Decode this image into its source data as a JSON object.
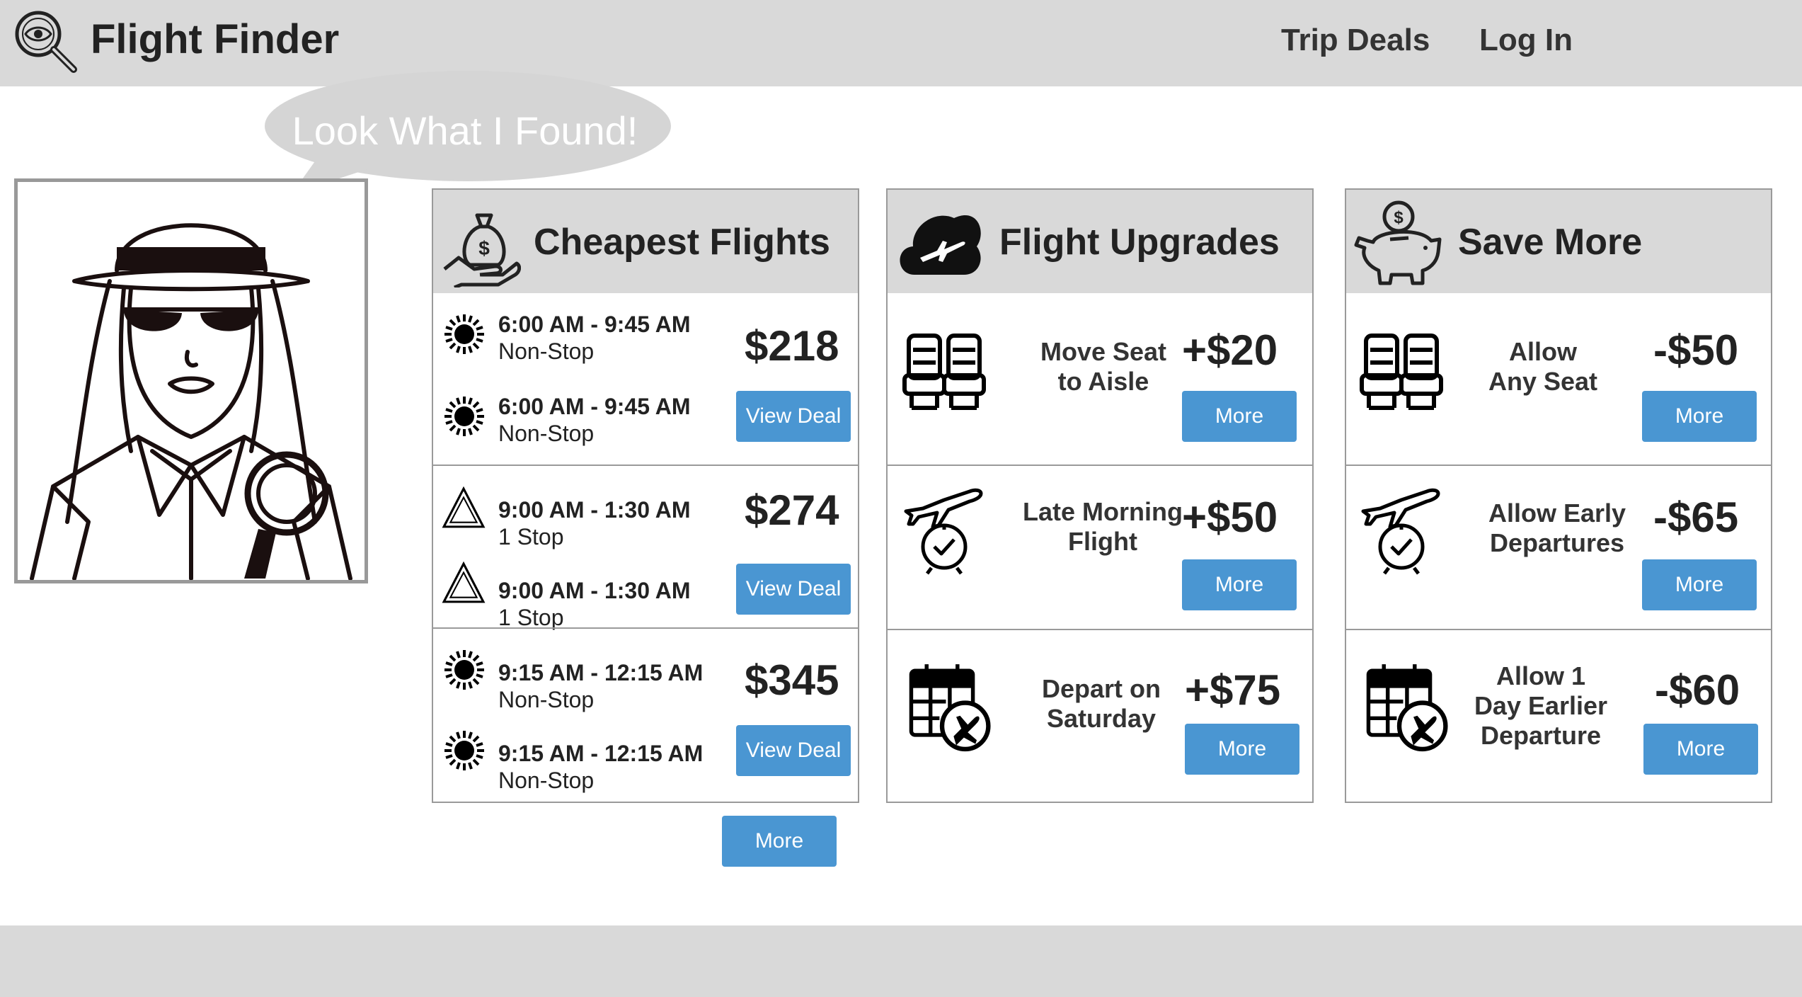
{
  "header": {
    "brand": "Flight Finder",
    "nav": [
      "Trip Deals",
      "Log In"
    ]
  },
  "speech_bubble": "Look What I Found!",
  "cheapest": {
    "title": "Cheapest Flights",
    "deals": [
      {
        "icon": "sun-icon",
        "outbound": {
          "time": "6:00 AM - 9:45 AM",
          "stops": "Non-Stop"
        },
        "return": {
          "time": "6:00 AM - 9:45 AM",
          "stops": "Non-Stop"
        },
        "price": "$218",
        "button": "View Deal"
      },
      {
        "icon": "triangle-icon",
        "outbound": {
          "time": "9:00 AM - 1:30 AM",
          "stops": "1 Stop"
        },
        "return": {
          "time": "9:00 AM - 1:30 AM",
          "stops": "1 Stop"
        },
        "price": "$274",
        "button": "View Deal"
      },
      {
        "icon": "sun-icon",
        "outbound": {
          "time": "9:15 AM - 12:15 AM",
          "stops": "Non-Stop"
        },
        "return": {
          "time": "9:15 AM - 12:15 AM",
          "stops": "Non-Stop"
        },
        "price": "$345",
        "button": "View Deal"
      }
    ],
    "more_button": "More"
  },
  "upgrades": {
    "title": "Flight Upgrades",
    "items": [
      {
        "icon": "seats-icon",
        "label": "Move Seat\nto Aisle",
        "price": "+$20",
        "button": "More"
      },
      {
        "icon": "plane-clock-icon",
        "label": "Late Morning\nFlight",
        "price": "+$50",
        "button": "More"
      },
      {
        "icon": "calendar-plane-icon",
        "label": "Depart on\nSaturday",
        "price": "+$75",
        "button": "More"
      }
    ]
  },
  "save": {
    "title": "Save More",
    "items": [
      {
        "icon": "seats-icon",
        "label": "Allow\nAny Seat",
        "price": "-$50",
        "button": "More"
      },
      {
        "icon": "plane-clock-icon",
        "label": "Allow Early\nDepartures",
        "price": "-$65",
        "button": "More"
      },
      {
        "icon": "calendar-plane-icon",
        "label": "Allow 1\nDay Earlier\nDeparture",
        "price": "-$60",
        "button": "More"
      }
    ]
  },
  "colors": {
    "header_bg": "#d9d9d9",
    "button": "#4a96d2",
    "bubble": "#d5d5d5"
  }
}
